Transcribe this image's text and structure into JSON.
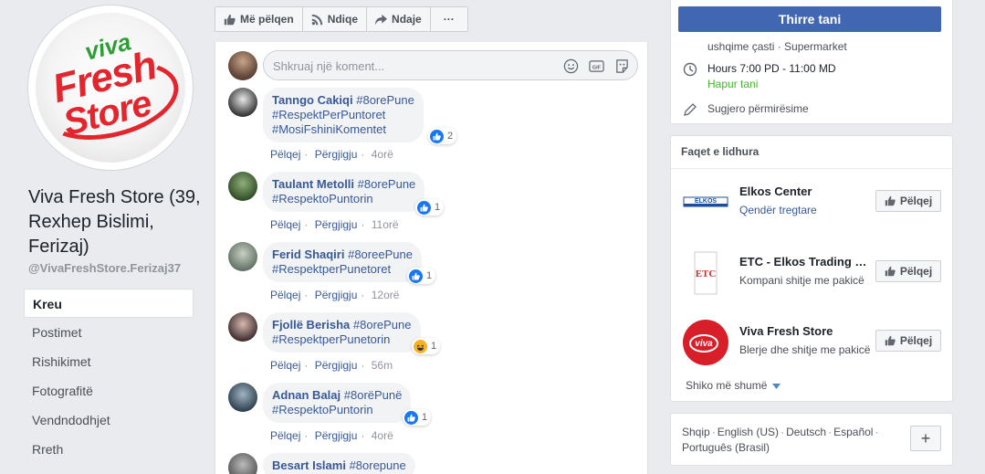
{
  "page": {
    "name": "Viva Fresh Store (39, Rexhep Bislimi, Ferizaj)",
    "handle": "@VivaFreshStore.Ferizaj37",
    "logo_text": {
      "viva": "viva",
      "fresh": "Fresh",
      "store": "Store"
    }
  },
  "nav": [
    {
      "label": "Kreu",
      "active": true
    },
    {
      "label": "Postimet"
    },
    {
      "label": "Rishikimet"
    },
    {
      "label": "Fotografitë"
    },
    {
      "label": "Vendndodhjet"
    },
    {
      "label": "Rreth"
    }
  ],
  "toolbar": {
    "like": "Më pëlqen",
    "follow": "Ndiqe",
    "share": "Ndaje",
    "more": "···"
  },
  "comment_box": {
    "placeholder": "Shkruaj një koment..."
  },
  "actions": {
    "like": "Pëlqej",
    "reply": "Përgjigju",
    "sep": "·"
  },
  "comments": [
    {
      "author": "Tanngo Cakiqi",
      "tags_line1": "#8orePune",
      "line2": "#RespektPerPuntoret",
      "line3": "#MosiFshiniKomentet",
      "reaction": "like",
      "count": "2",
      "time": "4orë",
      "avatar": "#3a3a3a"
    },
    {
      "author": "Taulant Metolli",
      "tags_line1": "#8orePune",
      "line2": "#RespektoPuntorin",
      "line3": "",
      "reaction": "like",
      "count": "1",
      "time": "11orë",
      "avatar": "#4b7a3c"
    },
    {
      "author": "Ferid Shaqiri",
      "tags_line1": "#8oreePune",
      "line2": "#RespektperPunetoret",
      "line3": "",
      "reaction": "like",
      "count": "1",
      "time": "12orë",
      "avatar": "#8a9a8c"
    },
    {
      "author": "Fjollë Berisha",
      "tags_line1": "#8orePune",
      "line2": "#RespektperPunetorin",
      "line3": "",
      "reaction": "haha",
      "count": "1",
      "time": "56m",
      "avatar": "#6a4a52"
    },
    {
      "author": "Adnan Balaj",
      "tags_line1": "#8orëPunë",
      "line2": "#RespektoPuntorin",
      "line3": "",
      "reaction": "like",
      "count": "1",
      "time": "4orë",
      "avatar": "#4a5e6e"
    },
    {
      "author": "Besart Islami",
      "tags_line1": "#8orepune",
      "line2": "",
      "line3": "",
      "reaction": "",
      "count": "",
      "time": "",
      "avatar": "#555555"
    }
  ],
  "cta": {
    "label": "Thirre tani"
  },
  "info": {
    "category": "ushqime çasti · Supermarket",
    "hours": "Hours 7:00 PD - 11:00 MD",
    "open_now": "Hapur tani",
    "suggest": "Sugjero përmirësime"
  },
  "related": {
    "title": "Faqet e lidhura",
    "pages": [
      {
        "name": "Elkos Center",
        "category": "Qendër tregtare",
        "category_link": true,
        "button": "Pëlqej",
        "logo": "ELKOS"
      },
      {
        "name": "ETC - Elkos Trading Company",
        "category": "Kompani shitje me pakicë",
        "category_link": false,
        "button": "Pëlqej",
        "logo": "ETC"
      },
      {
        "name": "Viva Fresh Store",
        "category": "Blerje dhe shitje me pakicë",
        "category_link": false,
        "button": "Pëlqej",
        "logo": "viva"
      }
    ],
    "see_more": "Shiko më shumë"
  },
  "languages": {
    "items": [
      "Shqip",
      "English (US)",
      "Deutsch",
      "Español",
      "Português (Brasil)"
    ],
    "sep": "·",
    "plus": "+"
  },
  "colors": {
    "brand_blue": "#4267b2",
    "link": "#385898",
    "green": "#42b72a",
    "logo_red": "#e3262e",
    "logo_green": "#2e9d36"
  }
}
